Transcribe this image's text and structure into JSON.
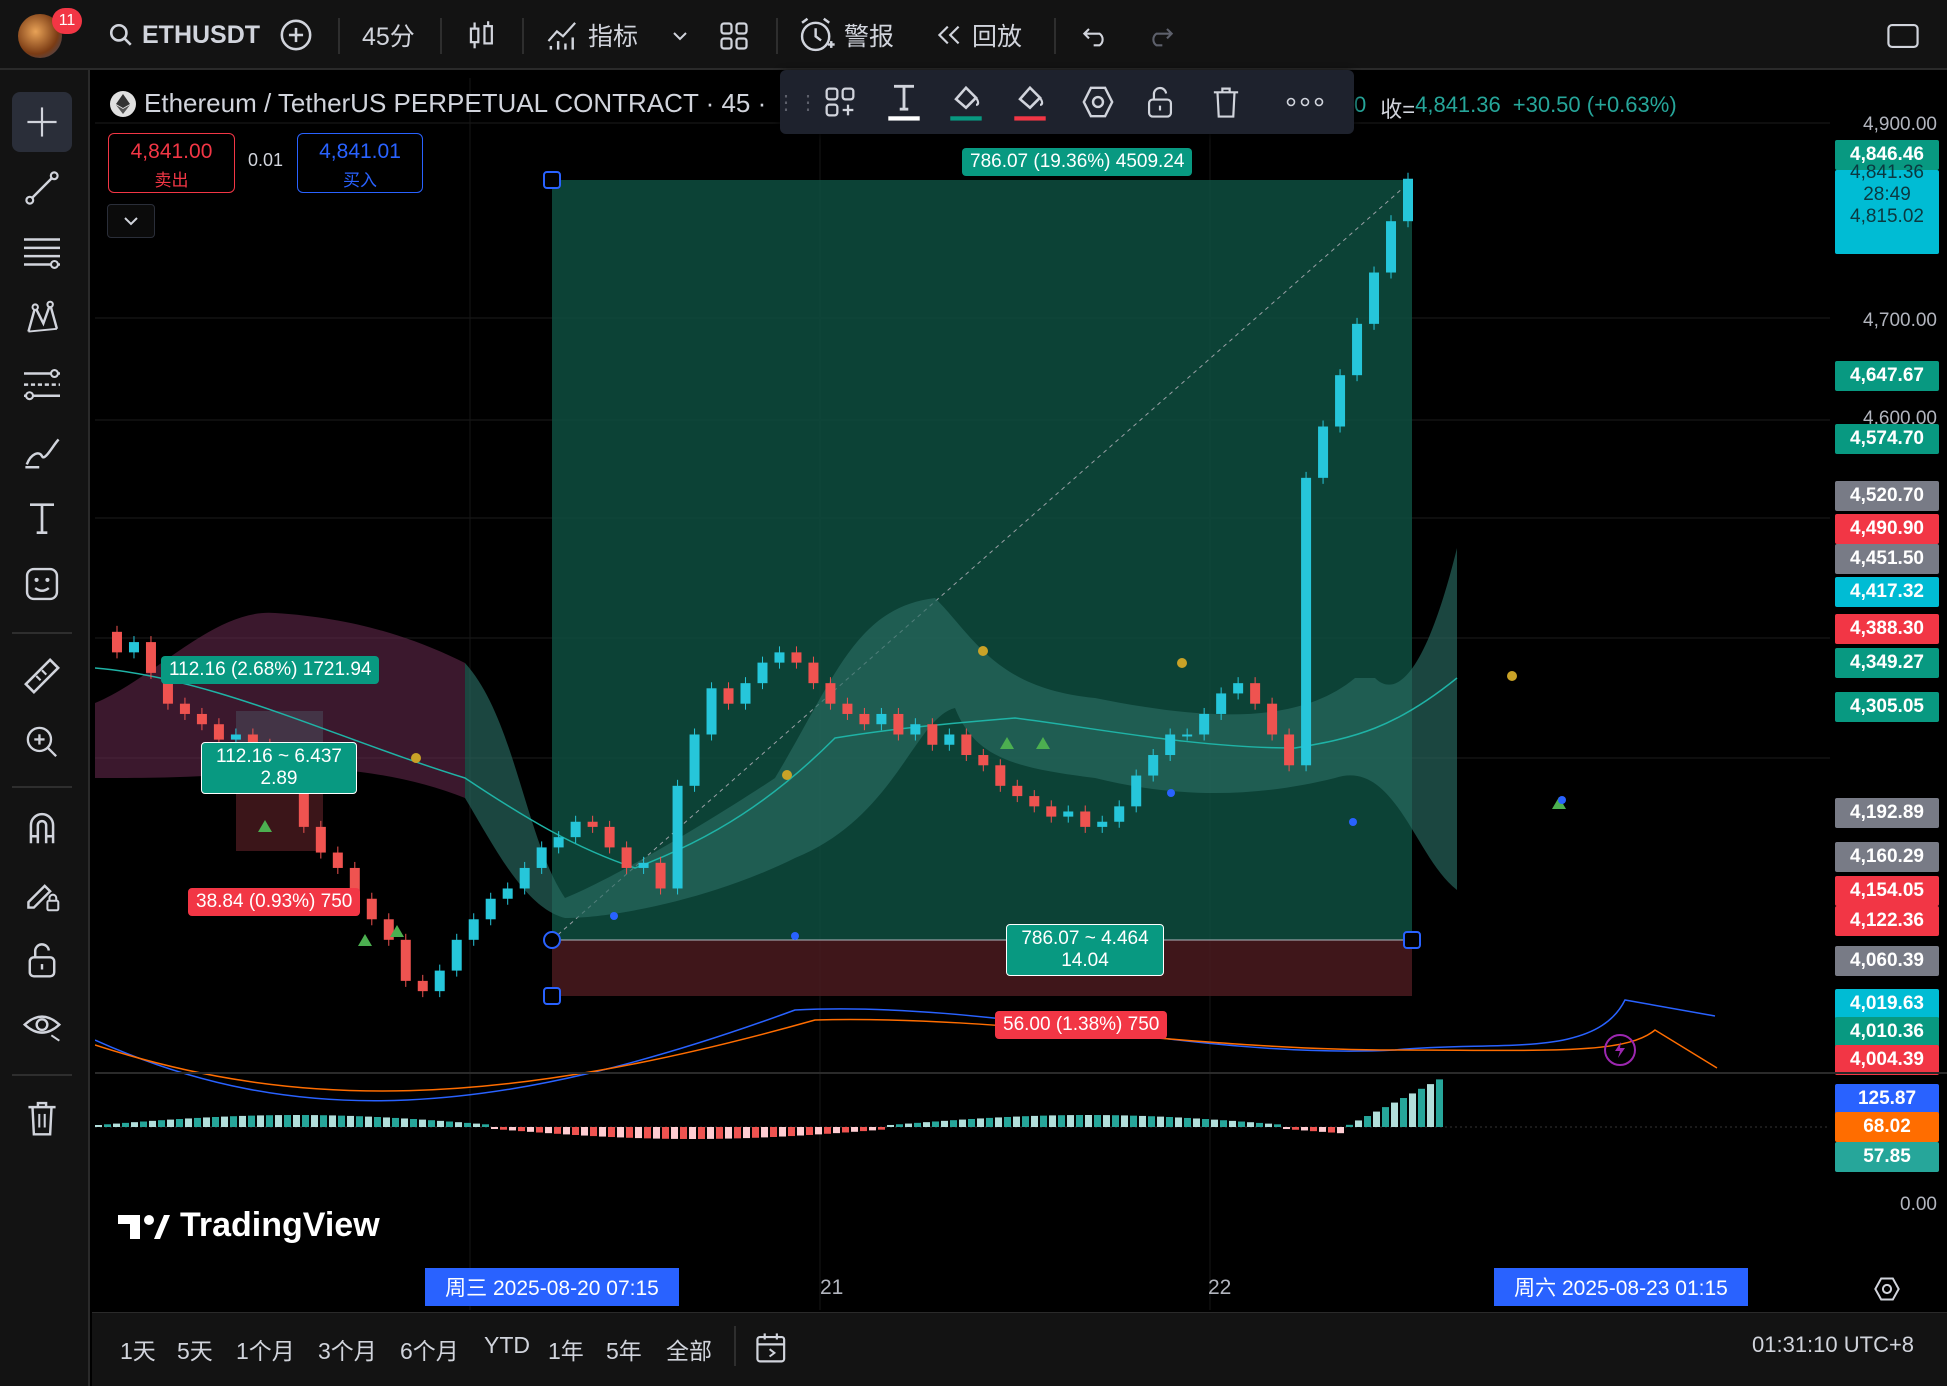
{
  "topbar": {
    "notification_count": "11",
    "symbol": "ETHUSDT",
    "interval": "45分",
    "indicators_label": "指标",
    "alert_label": "警报",
    "replay_label": "回放"
  },
  "legend": {
    "title": "Ethereum / TetherUS PERPETUAL CONTRACT · 45 ·",
    "close_label": "收=",
    "close_prefix": "0",
    "close_value": "4,841.36",
    "change": "+30.50 (+0.63%)"
  },
  "trade": {
    "sell_price": "4,841.00",
    "sell_label": "卖出",
    "spread": "0.01",
    "buy_price": "4,841.01",
    "buy_label": "买入"
  },
  "drawings": {
    "big_target": "786.07 (19.36%) 4509.24",
    "big_center_line1": "786.07 ~ 4.464",
    "big_center_line2": "14.04",
    "big_stop": "56.00 (1.38%) 750",
    "small_target": "112.16 (2.68%) 1721.94",
    "small_center_line1": "112.16 ~ 6.437",
    "small_center_line2": "2.89",
    "small_stop": "38.84 (0.93%) 750"
  },
  "price_scale": {
    "ticks": [
      "4,900.00",
      "4,700.00",
      "4,600.00"
    ],
    "labels": [
      {
        "text": "4,846.46",
        "color": "#089981"
      },
      {
        "text": "4,841.36",
        "color": "#00bcd4"
      },
      {
        "text": "28:49",
        "color": "#00bcd4"
      },
      {
        "text": "4,815.02",
        "color": "#00bcd4"
      },
      {
        "text": "4,647.67",
        "color": "#089981"
      },
      {
        "text": "4,574.70",
        "color": "#089981"
      },
      {
        "text": "4,520.70",
        "color": "#787b86"
      },
      {
        "text": "4,490.90",
        "color": "#f23645"
      },
      {
        "text": "4,451.50",
        "color": "#787b86"
      },
      {
        "text": "4,417.32",
        "color": "#00bcd4"
      },
      {
        "text": "4,388.30",
        "color": "#f23645"
      },
      {
        "text": "4,349.27",
        "color": "#089981"
      },
      {
        "text": "4,305.05",
        "color": "#089981"
      },
      {
        "text": "4,192.89",
        "color": "#787b86"
      },
      {
        "text": "4,160.29",
        "color": "#787b86"
      },
      {
        "text": "4,154.05",
        "color": "#f23645"
      },
      {
        "text": "4,122.36",
        "color": "#f23645"
      },
      {
        "text": "4,060.39",
        "color": "#787b86"
      },
      {
        "text": "4,019.63",
        "color": "#00bcd4"
      },
      {
        "text": "4,010.36",
        "color": "#089981"
      },
      {
        "text": "4,004.39",
        "color": "#f23645"
      }
    ],
    "macd_labels": [
      {
        "text": "125.87",
        "color": "#2962ff"
      },
      {
        "text": "68.02",
        "color": "#ff6d00"
      },
      {
        "text": "57.85",
        "color": "#26a69a"
      }
    ],
    "macd_zero": "0.00"
  },
  "time_axis": {
    "start_label": "周三 2025-08-20   07:15",
    "tick_21": "21",
    "tick_22": "22",
    "end_label": "周六 2025-08-23   01:15"
  },
  "bottombar": {
    "ranges": [
      "1天",
      "5天",
      "1个月",
      "3个月",
      "6个月",
      "YTD",
      "1年",
      "5年",
      "全部"
    ],
    "clock": "01:31:10 UTC+8"
  },
  "watermark": "TradingView",
  "chart_data": {
    "type": "candlestick",
    "title": "Ethereum / TetherUS PERPETUAL CONTRACT · 45",
    "ylim": [
      3980,
      4920
    ],
    "last_close": 4841.36,
    "close_path": [
      4400,
      4380,
      4390,
      4360,
      4330,
      4320,
      4310,
      4295,
      4300,
      4290,
      4280,
      4250,
      4210,
      4185,
      4170,
      4140,
      4120,
      4100,
      4060,
      4050,
      4070,
      4100,
      4120,
      4140,
      4150,
      4170,
      4190,
      4200,
      4215,
      4210,
      4190,
      4170,
      4175,
      4150,
      4250,
      4300,
      4345,
      4330,
      4350,
      4370,
      4380,
      4370,
      4350,
      4330,
      4320,
      4310,
      4320,
      4300,
      4310,
      4290,
      4300,
      4280,
      4270,
      4250,
      4240,
      4230,
      4220,
      4225,
      4210,
      4215,
      4230,
      4260,
      4280,
      4300,
      4300,
      4320,
      4340,
      4350,
      4330,
      4300,
      4270,
      4550,
      4600,
      4650,
      4700,
      4750,
      4800,
      4841.36
    ]
  }
}
